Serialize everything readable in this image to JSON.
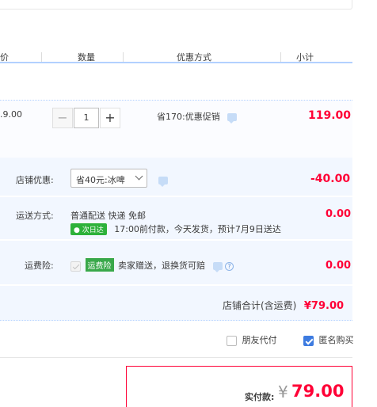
{
  "header": {
    "col_price": "价",
    "col_qty": "数量",
    "col_promo": "优惠方式",
    "col_subtotal": "小计"
  },
  "item": {
    "unit_price_fragment": ".9.00",
    "quantity": "1",
    "minus": "−",
    "plus": "+",
    "promo_text": "省170:优惠促销",
    "subtotal": "119.00"
  },
  "shop_discount": {
    "label": "店铺优惠:",
    "selected": "省40元:冰啤",
    "amount": "-40.00"
  },
  "shipping": {
    "label": "运送方式:",
    "method": "普通配送 快递 免邮",
    "badge": "次日达",
    "note": "17:00前付款，今天发货，预计7月9日送达",
    "amount": "0.00"
  },
  "insurance": {
    "label": "运费险:",
    "tag": "运费险",
    "text": "卖家赠送，退换货可赔",
    "amount": "0.00"
  },
  "shop_total": {
    "label": "店铺合计(含运费)",
    "amount": "¥79.00"
  },
  "options": {
    "friend_pay": "朋友代付",
    "anonymous": "匿名购买"
  },
  "payment": {
    "label": "实付款:",
    "currency": "¥",
    "amount": "79.00"
  },
  "colors": {
    "accent_red": "#ff0036",
    "blue_band": "#f2f7ff",
    "border_blue": "#b2d1ff",
    "green": "#2db13a"
  }
}
